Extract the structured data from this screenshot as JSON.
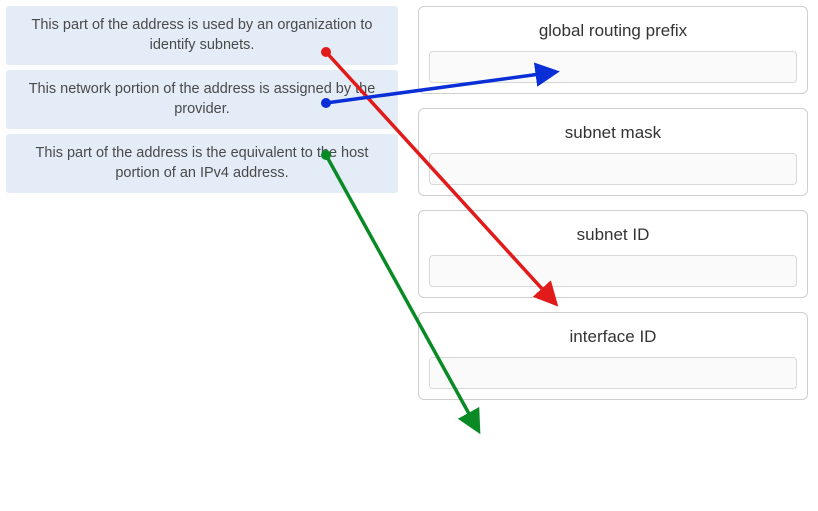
{
  "sources": [
    {
      "text": "This part of the address is used by an organization to identify subnets."
    },
    {
      "text": "This network portion of the address is assigned by the provider."
    },
    {
      "text": "This part of the address is the equivalent to the host portion of an IPv4 address."
    }
  ],
  "targets": [
    {
      "label": "global routing prefix"
    },
    {
      "label": "subnet mask"
    },
    {
      "label": "subnet ID"
    },
    {
      "label": "interface ID"
    }
  ],
  "connections": [
    {
      "from": 0,
      "to": 2,
      "color": "#e11a1a"
    },
    {
      "from": 1,
      "to": 0,
      "color": "#0b2fd6"
    },
    {
      "from": 2,
      "to": 3,
      "color": "#0a8a25"
    }
  ]
}
